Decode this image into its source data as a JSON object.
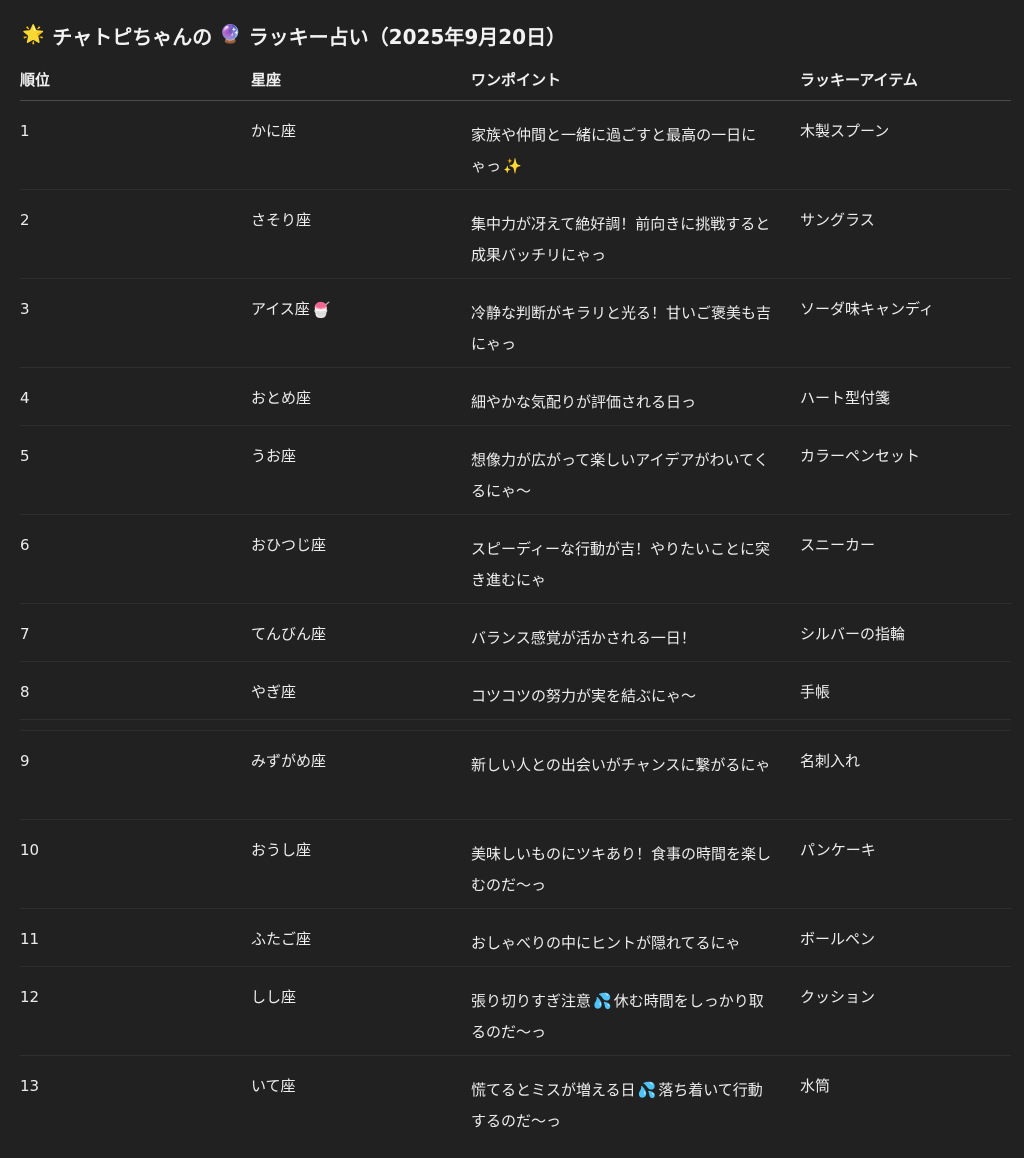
{
  "title": {
    "icon_sun": "🌟",
    "text_1": "チャトピちゃんの",
    "icon_crystal": "🔮",
    "text_2": "ラッキー占い（2025年9月20日）"
  },
  "table": {
    "headers": [
      "順位",
      "星座",
      "ワンポイント",
      "ラッキーアイテム"
    ],
    "rows": [
      {
        "rank": "1",
        "sign": "かに座",
        "point": "家族や仲間と一緒に過ごすと最高の一日にゃっ",
        "point_emoji": "✨",
        "item": "木製スプーン"
      },
      {
        "rank": "2",
        "sign": "さそり座",
        "point": "集中力が冴えて絶好調！前向きに挑戦すると成果バッチリにゃっ",
        "item": "サングラス"
      },
      {
        "rank": "3",
        "sign": "アイス座",
        "sign_emoji": "🍧",
        "point": "冷静な判断がキラリと光る！甘いご褒美も吉にゃっ",
        "item": "ソーダ味キャンディ"
      },
      {
        "rank": "4",
        "sign": "おとめ座",
        "point": "細やかな気配りが評価される日っ",
        "item": "ハート型付箋"
      },
      {
        "rank": "5",
        "sign": "うお座",
        "point": "想像力が広がって楽しいアイデアがわいてくるにゃ〜",
        "item": "カラーペンセット"
      },
      {
        "rank": "6",
        "sign": "おひつじ座",
        "point": "スピーディーな行動が吉！やりたいことに突き進むにゃ",
        "item": "スニーカー"
      },
      {
        "rank": "7",
        "sign": "てんびん座",
        "point": "バランス感覚が活かされる一日！",
        "item": "シルバーの指輪"
      },
      {
        "rank": "8",
        "sign": "やぎ座",
        "point": "コツコツの努力が実を結ぶにゃ〜",
        "item": "手帳"
      },
      {
        "rank": "9",
        "sign": "みずがめ座",
        "point": "新しい人との出会いがチャンスに繋がるにゃ",
        "item": "名刺入れ"
      },
      {
        "rank": "10",
        "sign": "おうし座",
        "point": "美味しいものにツキあり！食事の時間を楽しむのだ〜っ",
        "item": "パンケーキ"
      },
      {
        "rank": "11",
        "sign": "ふたご座",
        "point": "おしゃべりの中にヒントが隠れてるにゃ",
        "item": "ボールペン"
      },
      {
        "rank": "12",
        "sign": "しし座",
        "point_a": "張り切りすぎ注意",
        "point_emoji": "💦",
        "point_b": "休む時間をしっかり取るのだ〜っ",
        "item": "クッション"
      },
      {
        "rank": "13",
        "sign": "いて座",
        "point_a": "慌てるとミスが増える日",
        "point_emoji": "💦",
        "point_b": "落ち着いて行動するのだ〜っ",
        "item": "水筒"
      }
    ]
  }
}
